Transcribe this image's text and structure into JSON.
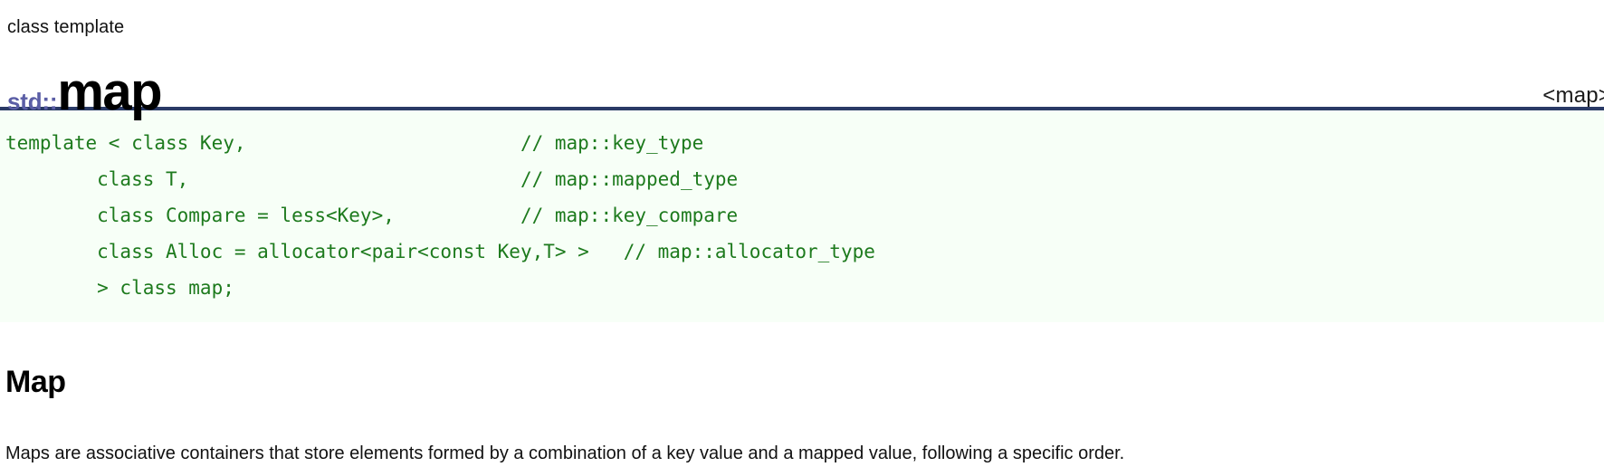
{
  "page": {
    "kind_label": "class template",
    "namespace": "std::",
    "class_name": "map",
    "header_name": "<map>",
    "divider_color": "#2a3a66",
    "namespace_color": "#5b5ea6"
  },
  "code_block": {
    "background_color": "#f7fff7",
    "text_color": "#1d7a1d",
    "lines": [
      {
        "code": "template < class Key,",
        "comment": "// map::key_type"
      },
      {
        "code": "        class T,",
        "comment": "// map::mapped_type"
      },
      {
        "code": "        class Compare = less<Key>,",
        "comment": "// map::key_compare"
      },
      {
        "code": "        class Alloc = allocator<pair<const Key,T> >",
        "comment": "// map::allocator_type"
      },
      {
        "code": "        > class map;",
        "comment": ""
      }
    ],
    "rendered_lines": [
      "template < class Key,                        // map::key_type",
      "        class T,                             // map::mapped_type",
      "        class Compare = less<Key>,           // map::key_compare",
      "        class Alloc = allocator<pair<const Key,T> >   // map::allocator_type",
      "        > class map;"
    ]
  },
  "section": {
    "heading": "Map",
    "paragraph": "Maps are associative containers that store elements formed by a combination of a key value and a mapped value, following a specific order."
  }
}
